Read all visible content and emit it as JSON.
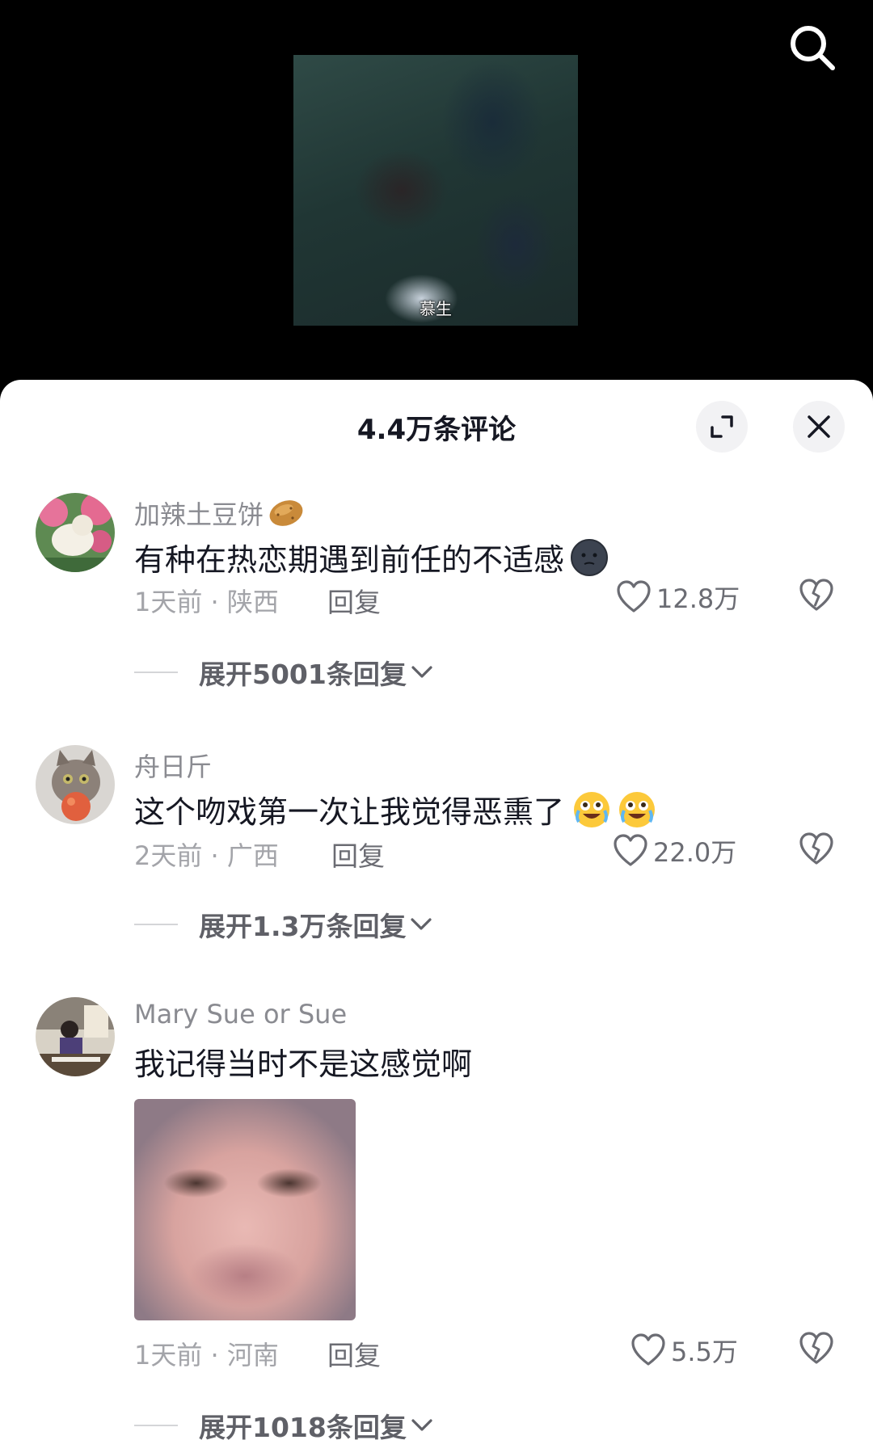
{
  "video": {
    "subtitle": "慕生"
  },
  "sheet": {
    "title": "4.4万条评论"
  },
  "comments": [
    {
      "username": "加辣土豆饼",
      "username_emoji": "potato-emoji",
      "text": "有种在热恋期遇到前任的不适感",
      "text_emoji": "dark-moon-face-emoji",
      "meta": "1天前 · 陕西",
      "reply_label": "回复",
      "likes": "12.8万",
      "expand_label": "展开5001条回复"
    },
    {
      "username": "舟日斤",
      "text": "这个吻戏第一次让我觉得恶熏了",
      "text_emoji": "crying-laughing-emoji ×2",
      "meta": "2天前 · 广西",
      "reply_label": "回复",
      "likes": "22.0万",
      "expand_label": "展开1.3万条回复"
    },
    {
      "username": "Mary Sue or Sue",
      "text": "我记得当时不是这感觉啊",
      "meta": "1天前 · 河南",
      "reply_label": "回复",
      "likes": "5.5万",
      "expand_label": "展开1018条回复"
    }
  ],
  "colors": {
    "sheet_bg": "#ffffff",
    "primary_text": "#161823",
    "secondary_text": "#8a8b91",
    "meta_text": "#a3a4a9"
  }
}
